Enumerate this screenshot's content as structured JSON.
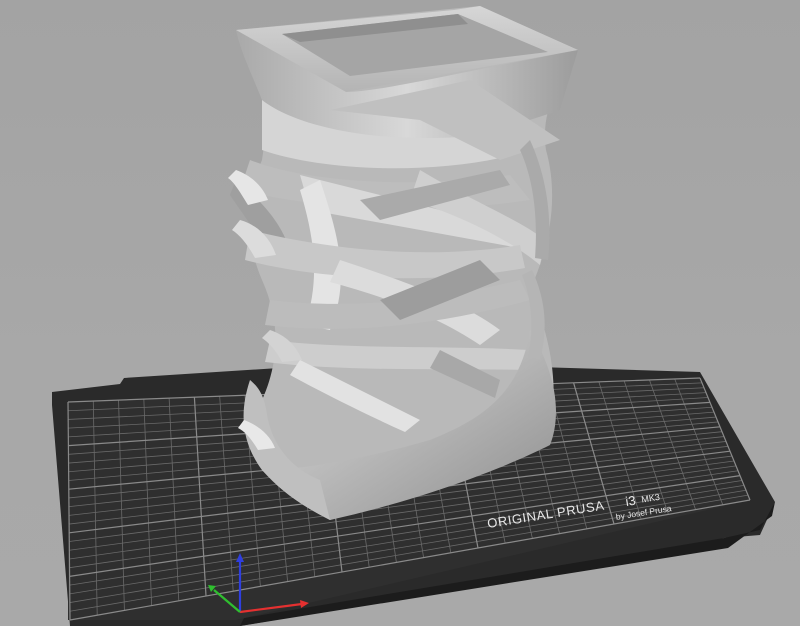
{
  "app": {
    "view": "3D build plate view"
  },
  "bed": {
    "brand_line": "ORIGINAL PRUSA",
    "model": "i3",
    "variant": "MK3",
    "credit": "by Josef Prusa"
  },
  "object": {
    "description_icon": "vase-model-icon"
  },
  "axes": {
    "x_color": "#e53030",
    "y_color": "#2fbf2f",
    "z_color": "#2f3fe0"
  },
  "colors": {
    "background": "#a6a6a6",
    "bed_surface": "#2b2b2b",
    "grid_line": "#6d6d6d",
    "model": "#c8c8c8"
  }
}
